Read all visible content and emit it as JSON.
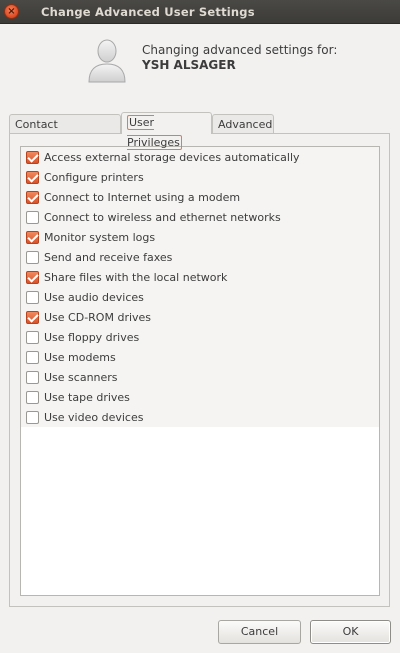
{
  "window": {
    "title": "Change Advanced User Settings",
    "close_icon": "close-icon"
  },
  "header": {
    "subtitle": "Changing advanced settings for:",
    "user_name": "YSH ALSAGER"
  },
  "tabs": [
    {
      "label": "Contact Information",
      "active": false
    },
    {
      "label": "User Privileges",
      "active": true
    },
    {
      "label": "Advanced",
      "active": false
    }
  ],
  "privileges": [
    {
      "label": "Access external storage devices automatically",
      "checked": true
    },
    {
      "label": "Configure printers",
      "checked": true
    },
    {
      "label": "Connect to Internet using a modem",
      "checked": true
    },
    {
      "label": "Connect to wireless and ethernet networks",
      "checked": false
    },
    {
      "label": "Monitor system logs",
      "checked": true
    },
    {
      "label": "Send and receive faxes",
      "checked": false
    },
    {
      "label": "Share files with the local network",
      "checked": true
    },
    {
      "label": "Use audio devices",
      "checked": false
    },
    {
      "label": "Use CD-ROM drives",
      "checked": true
    },
    {
      "label": "Use floppy drives",
      "checked": false
    },
    {
      "label": "Use modems",
      "checked": false
    },
    {
      "label": "Use scanners",
      "checked": false
    },
    {
      "label": "Use tape drives",
      "checked": false
    },
    {
      "label": "Use video devices",
      "checked": false
    }
  ],
  "buttons": {
    "cancel": "Cancel",
    "ok": "OK"
  },
  "colors": {
    "accent": "#dd5a2c",
    "titlebar": "#3c3b37"
  }
}
